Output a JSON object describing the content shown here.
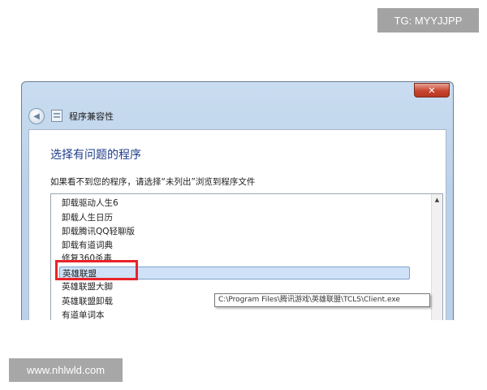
{
  "watermarks": {
    "top": "TG: MYYJJPP",
    "bottom": "www.nhlwld.com"
  },
  "window": {
    "close_label": "✕",
    "nav_title": "程序兼容性",
    "heading": "选择有问题的程序",
    "instruction": "如果看不到您的程序，请选择“未列出”浏览到程序文件"
  },
  "programs": [
    "卸载驱动人生6",
    "卸载人生日历",
    "卸载腾讯QQ轻聊版",
    "卸载有道词典",
    "修复360杀毒",
    "英雄联盟",
    "英雄联盟大脚",
    "英雄联盟卸载",
    "有道单词本"
  ],
  "selected_program": "英雄联盟",
  "tooltip": "C:\\Program Files\\腾讯游戏\\英雄联盟\\TCLS\\Client.exe",
  "icons": {
    "back": "back-arrow-icon",
    "app": "program-icon",
    "close": "close-icon",
    "scroll_up": "scroll-up-arrow-icon"
  },
  "colors": {
    "highlight": "#e8242b",
    "heading": "#1f3d8a",
    "selection": "#cfe2f7"
  }
}
